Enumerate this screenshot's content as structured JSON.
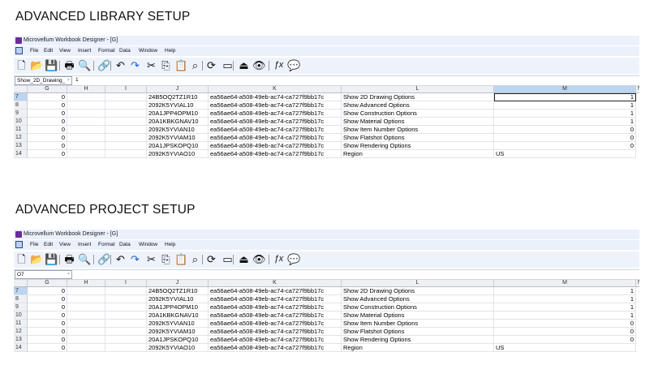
{
  "sections": [
    {
      "heading": "ADVANCED LIBRARY SETUP",
      "window_title": "Microvellum Workbook Designer - [G]",
      "menu": [
        "File",
        "Edit",
        "View",
        "Insert",
        "Format",
        "Data",
        "Window",
        "Help"
      ],
      "toolbar": [
        "new-icon",
        "open-icon",
        "save-icon",
        "print-icon",
        "print-preview-icon",
        "link-icon",
        "undo-icon",
        "redo-icon",
        "cut-icon",
        "copy-icon",
        "paste-icon",
        "zoom-icon",
        "refresh-icon",
        "window-icon",
        "eject-icon",
        "eye-icon",
        "function-icon",
        "comment-icon"
      ],
      "name_box": "Show_2D_Drawing_",
      "formula_value": "1",
      "selected_column": "M",
      "selected_row": "7",
      "columns": [
        "G",
        "H",
        "I",
        "J",
        "K",
        "L",
        "M"
      ],
      "rows": [
        {
          "r": "7",
          "g": "0",
          "h": "",
          "i": "",
          "j": "24B5OQ2TZ1R10",
          "k": "ea56ae64-a508-49eb-ac74-ca727f9bb17c",
          "l": "Show 2D Drawing Options",
          "m": "1"
        },
        {
          "r": "8",
          "g": "0",
          "h": "",
          "i": "",
          "j": "2092K5YVIAL10",
          "k": "ea56ae64-a508-49eb-ac74-ca727f9bb17c",
          "l": "Show Advanced Options",
          "m": "1"
        },
        {
          "r": "9",
          "g": "0",
          "h": "",
          "i": "",
          "j": "20A1JPP4OPM10",
          "k": "ea56ae64-a508-49eb-ac74-ca727f9bb17c",
          "l": "Show Construction Options",
          "m": "1"
        },
        {
          "r": "10",
          "g": "0",
          "h": "",
          "i": "",
          "j": "20A1KBKGNAV10",
          "k": "ea56ae64-a508-49eb-ac74-ca727f9bb17c",
          "l": "Show Material Options",
          "m": "1"
        },
        {
          "r": "11",
          "g": "0",
          "h": "",
          "i": "",
          "j": "2092K5YVIAN10",
          "k": "ea56ae64-a508-49eb-ac74-ca727f9bb17c",
          "l": "Show Item Number Options",
          "m": "0"
        },
        {
          "r": "12",
          "g": "0",
          "h": "",
          "i": "",
          "j": "2092K5YVIAM10",
          "k": "ea56ae64-a508-49eb-ac74-ca727f9bb17c",
          "l": "Show Flatshot Options",
          "m": "0"
        },
        {
          "r": "13",
          "g": "0",
          "h": "",
          "i": "",
          "j": "20A1JPSKOPQ10",
          "k": "ea56ae64-a508-49eb-ac74-ca727f9bb17c",
          "l": "Show Rendering Options",
          "m": "0"
        },
        {
          "r": "14",
          "g": "0",
          "h": "",
          "i": "",
          "j": "2092K5YVIAO10",
          "k": "ea56ae64-a508-49eb-ac74-ca727f9bb17c",
          "l": "Region",
          "m": "US"
        }
      ]
    },
    {
      "heading": "ADVANCED PROJECT SETUP",
      "window_title": "Microvellum Workbook Designer - [G]",
      "menu": [
        "File",
        "Edit",
        "View",
        "Insert",
        "Format",
        "Data",
        "Window",
        "Help"
      ],
      "toolbar": [
        "new-icon",
        "open-icon",
        "save-icon",
        "print-icon",
        "print-preview-icon",
        "link-icon",
        "undo-icon",
        "redo-icon",
        "cut-icon",
        "copy-icon",
        "paste-icon",
        "zoom-icon",
        "refresh-icon",
        "window-icon",
        "eject-icon",
        "eye-icon",
        "function-icon",
        "comment-icon"
      ],
      "name_box": "O7",
      "formula_value": "",
      "selected_column": "",
      "selected_row": "7",
      "columns": [
        "G",
        "H",
        "I",
        "J",
        "K",
        "L",
        "M"
      ],
      "rows": [
        {
          "r": "7",
          "g": "0",
          "h": "",
          "i": "",
          "j": "24B5OQ2TZ1R10",
          "k": "ea56ae64-a508-49eb-ac74-ca727f9bb17c",
          "l": "Show 2D Drawing Options",
          "m": "1"
        },
        {
          "r": "8",
          "g": "0",
          "h": "",
          "i": "",
          "j": "2092K5YVIAL10",
          "k": "ea56ae64-a508-49eb-ac74-ca727f9bb17c",
          "l": "Show Advanced Options",
          "m": "1"
        },
        {
          "r": "9",
          "g": "0",
          "h": "",
          "i": "",
          "j": "20A1JPP4OPM10",
          "k": "ea56ae64-a508-49eb-ac74-ca727f9bb17c",
          "l": "Show Construction Options",
          "m": "1"
        },
        {
          "r": "10",
          "g": "0",
          "h": "",
          "i": "",
          "j": "20A1KBKGNAV10",
          "k": "ea56ae64-a508-49eb-ac74-ca727f9bb17c",
          "l": "Show Material Options",
          "m": "1"
        },
        {
          "r": "11",
          "g": "0",
          "h": "",
          "i": "",
          "j": "2092K5YVIAN10",
          "k": "ea56ae64-a508-49eb-ac74-ca727f9bb17c",
          "l": "Show Item Number Options",
          "m": "0"
        },
        {
          "r": "12",
          "g": "0",
          "h": "",
          "i": "",
          "j": "2092K5YVIAM10",
          "k": "ea56ae64-a508-49eb-ac74-ca727f9bb17c",
          "l": "Show Flatshot Options",
          "m": "0"
        },
        {
          "r": "13",
          "g": "0",
          "h": "",
          "i": "",
          "j": "20A1JPSKOPQ10",
          "k": "ea56ae64-a508-49eb-ac74-ca727f9bb17c",
          "l": "Show Rendering Options",
          "m": "0"
        },
        {
          "r": "14",
          "g": "0",
          "h": "",
          "i": "",
          "j": "2092K5YVIAO10",
          "k": "ea56ae64-a508-49eb-ac74-ca727f9bb17c",
          "l": "Region",
          "m": "US"
        }
      ]
    }
  ],
  "colors": {
    "header_bg": "#eef0f4",
    "selected_header": "#bcd5f0",
    "app_logo": "#6a2ca0"
  }
}
